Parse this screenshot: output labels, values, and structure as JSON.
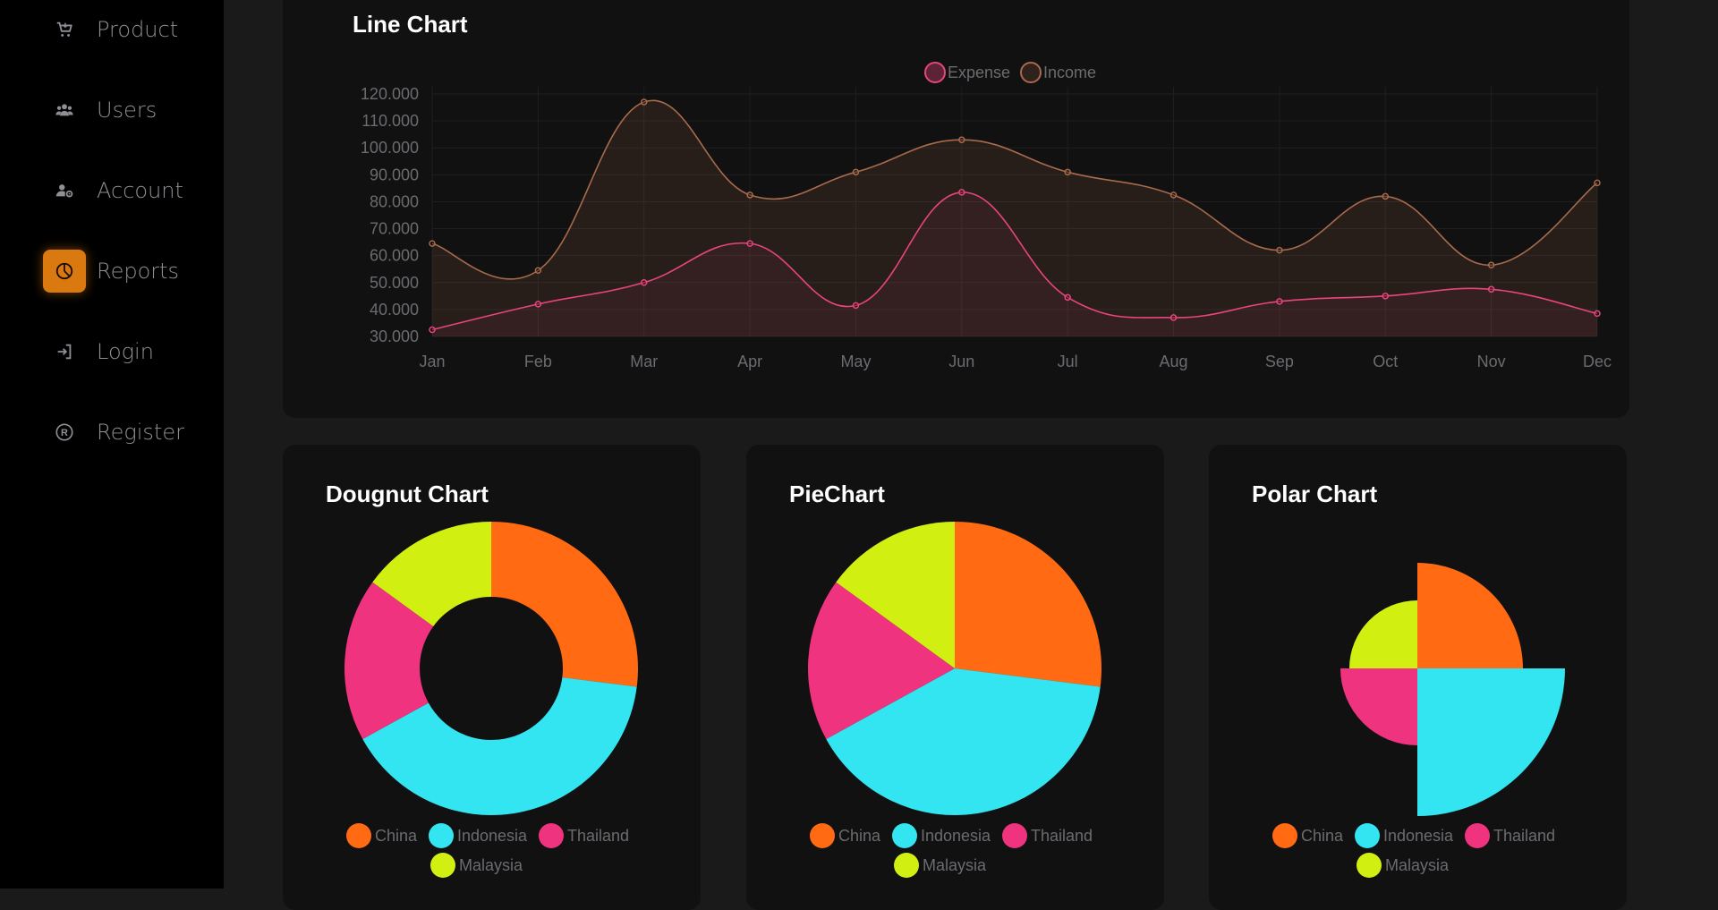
{
  "sidebar": {
    "items": [
      {
        "label": "Product",
        "icon": "cart-icon",
        "active": false
      },
      {
        "label": "Users",
        "icon": "users-icon",
        "active": false
      },
      {
        "label": "Account",
        "icon": "user-gear-icon",
        "active": false
      },
      {
        "label": "Reports",
        "icon": "pie-chart-icon",
        "active": true
      },
      {
        "label": "Login",
        "icon": "login-icon",
        "active": false
      },
      {
        "label": "Register",
        "icon": "registered-icon",
        "active": false
      }
    ],
    "accent_color": "#d9790f"
  },
  "line_card": {
    "title": "Line Chart"
  },
  "doughnut_card": {
    "title": "Dougnut Chart"
  },
  "pie_card": {
    "title": "PieChart"
  },
  "polar_card": {
    "title": "Polar Chart"
  },
  "chart_data": [
    {
      "type": "line",
      "title": "Line Chart",
      "categories": [
        "Jan",
        "Feb",
        "Mar",
        "Apr",
        "May",
        "Jun",
        "Jul",
        "Aug",
        "Sep",
        "Oct",
        "Nov",
        "Dec"
      ],
      "series": [
        {
          "name": "Expense",
          "color": "#e8457e",
          "values": [
            32500,
            42000,
            50000,
            64500,
            41500,
            83500,
            44500,
            37000,
            43000,
            45000,
            47500,
            38500
          ]
        },
        {
          "name": "Income",
          "color": "#a86a4c",
          "values": [
            64500,
            54500,
            117000,
            82500,
            91000,
            103000,
            91000,
            82500,
            62000,
            82000,
            56500,
            87000
          ]
        }
      ],
      "yticks": [
        "30.000",
        "40.000",
        "50.000",
        "60.000",
        "70.000",
        "80.000",
        "90.000",
        "100.000",
        "110.000",
        "120.000"
      ],
      "ylim": [
        30000,
        120000
      ],
      "legend": "top",
      "fill": true,
      "grid": true
    },
    {
      "type": "doughnut",
      "title": "Dougnut Chart",
      "categories": [
        "China",
        "Indonesia",
        "Thailand",
        "Malaysia"
      ],
      "values": [
        27,
        40,
        18,
        15
      ],
      "colors": [
        "#ff6a13",
        "#33e5f1",
        "#f0337e",
        "#d2ef12"
      ],
      "legend": "bottom"
    },
    {
      "type": "pie",
      "title": "PieChart",
      "categories": [
        "China",
        "Indonesia",
        "Thailand",
        "Malaysia"
      ],
      "values": [
        27,
        40,
        18,
        15
      ],
      "colors": [
        "#ff6a13",
        "#33e5f1",
        "#f0337e",
        "#d2ef12"
      ],
      "legend": "bottom"
    },
    {
      "type": "polar",
      "title": "Polar Chart",
      "categories": [
        "China",
        "Indonesia",
        "Thailand",
        "Malaysia"
      ],
      "values": [
        118,
        165,
        86,
        76
      ],
      "colors": [
        "#ff6a13",
        "#33e5f1",
        "#f0337e",
        "#d2ef12"
      ],
      "legend": "bottom"
    }
  ]
}
